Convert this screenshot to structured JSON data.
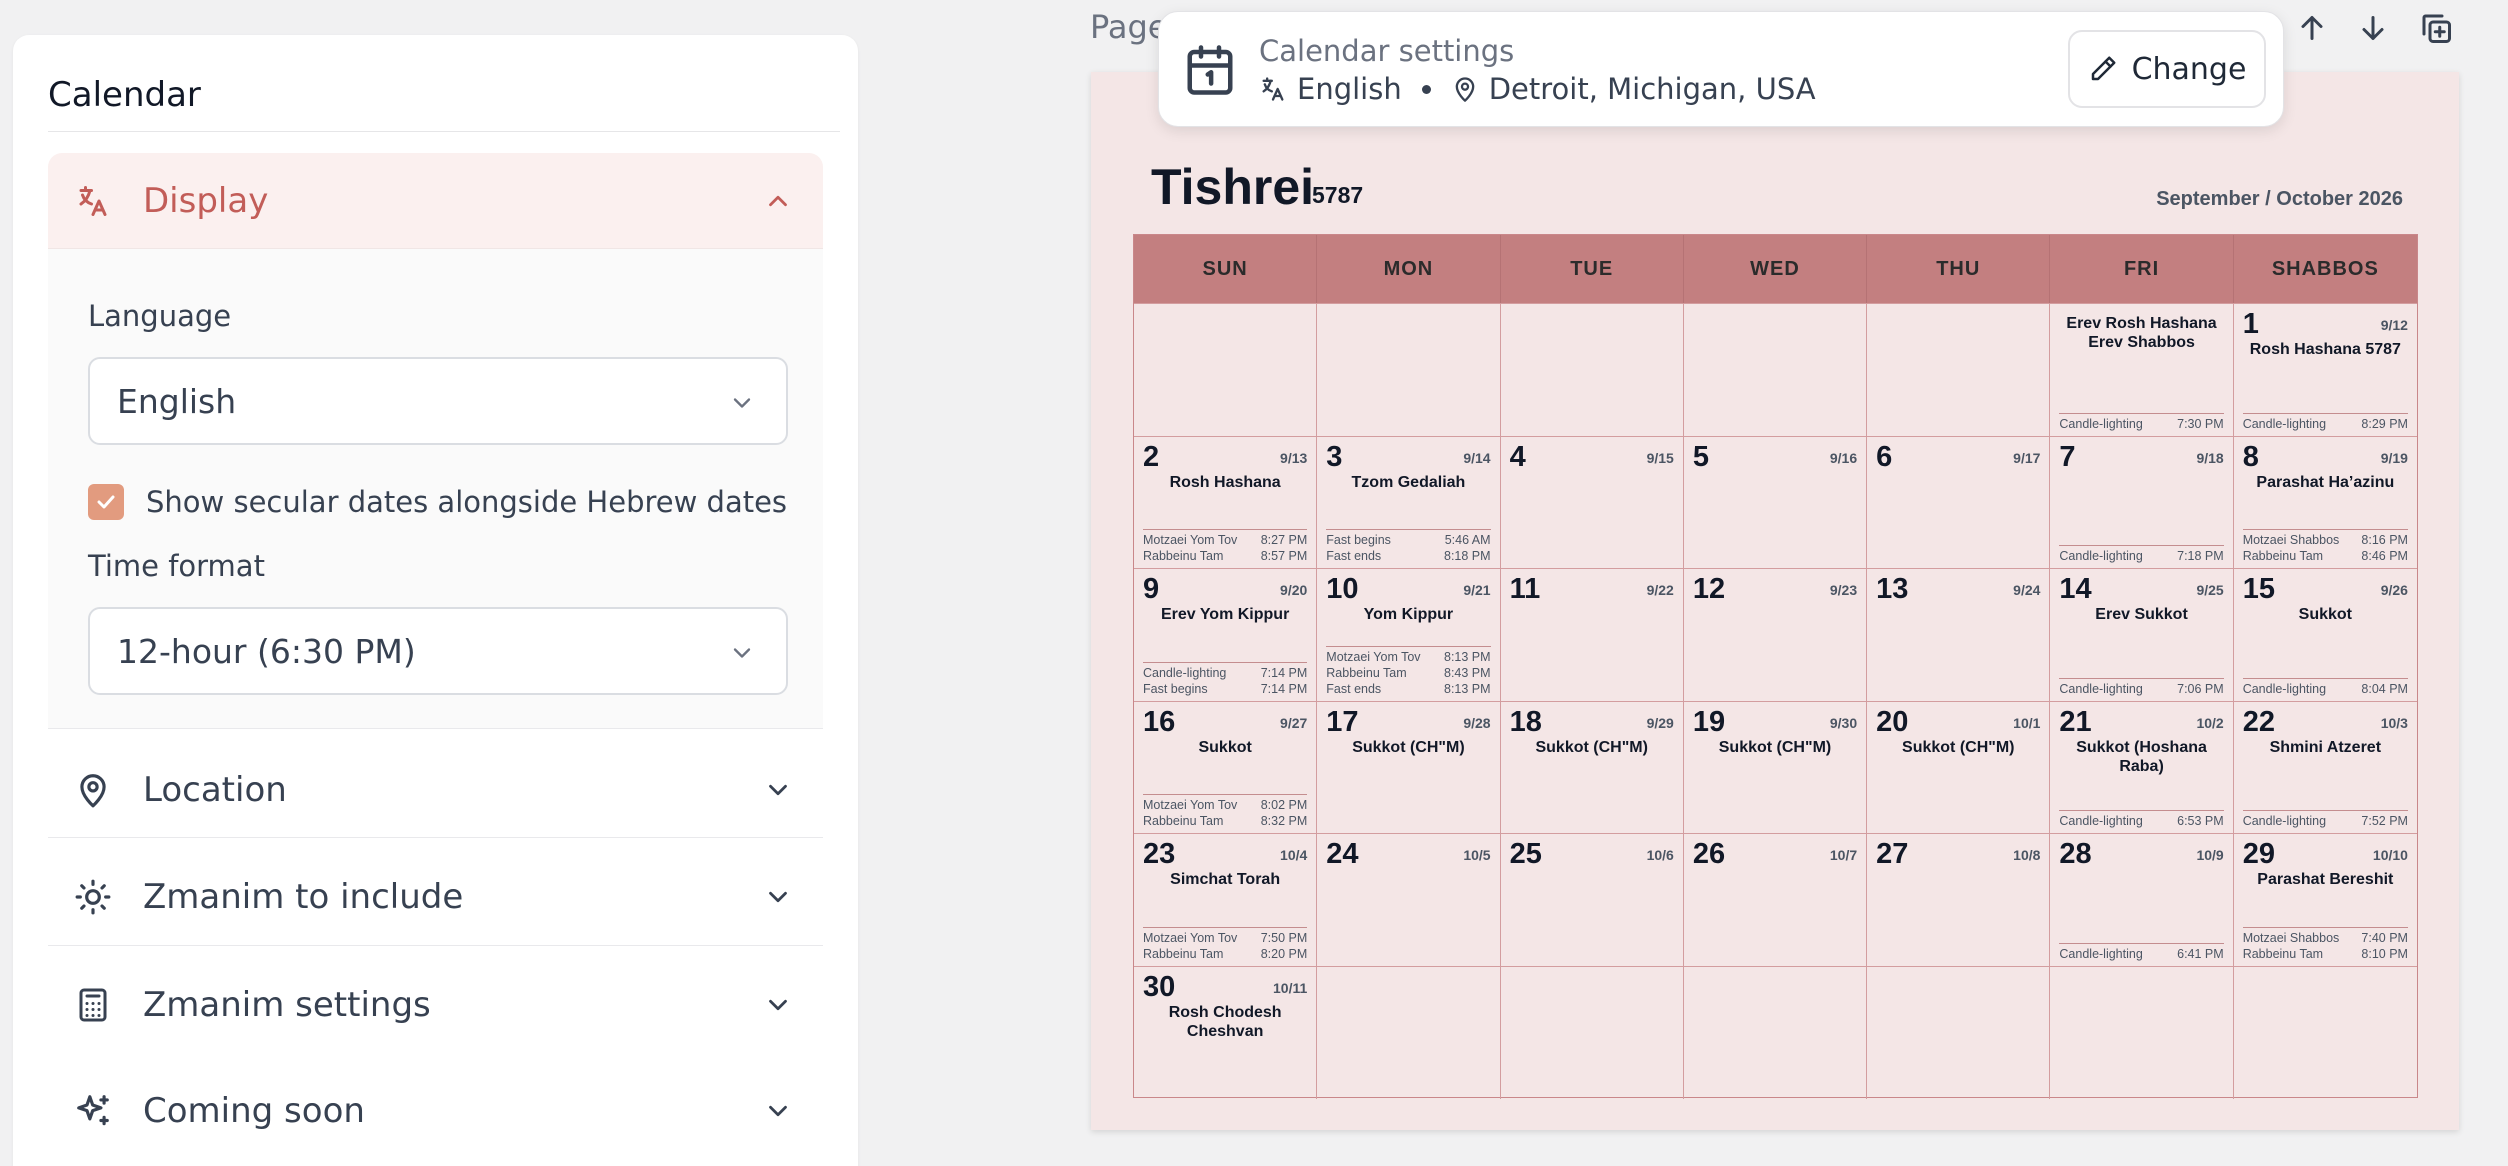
{
  "panel": {
    "title": "Calendar",
    "display": {
      "label": "Display",
      "language_label": "Language",
      "language_value": "English",
      "show_secular_label": "Show secular dates alongside Hebrew dates",
      "show_secular_checked": true,
      "time_format_label": "Time format",
      "time_format_value": "12-hour (6:30 PM)"
    },
    "sections": [
      {
        "label": "Location",
        "icon": "map-pin-icon"
      },
      {
        "label": "Zmanim to include",
        "icon": "sun-icon"
      },
      {
        "label": "Zmanim settings",
        "icon": "calculator-icon"
      },
      {
        "label": "Coming soon",
        "icon": "sparkles-icon"
      }
    ],
    "accent_color": "#c25d58"
  },
  "toolbar": {
    "page_label": "Page"
  },
  "popup": {
    "title": "Calendar settings",
    "language": "English",
    "location": "Detroit, Michigan, USA",
    "change_label": "Change"
  },
  "calendar": {
    "month": "Tishrei",
    "year": "5787",
    "secular_range": "September / October 2026",
    "days_of_week": [
      "SUN",
      "MON",
      "TUE",
      "WED",
      "THU",
      "FRI",
      "SHABBOS"
    ],
    "header_color": "#c37f80",
    "weeks": [
      [
        {},
        {},
        {},
        {},
        {},
        {
          "events": [
            "Erev Rosh Hashana",
            "Erev Shabbos"
          ],
          "zmanim": [
            [
              "Candle-lighting",
              "7:30 PM"
            ]
          ]
        },
        {
          "day": "1",
          "secular": "9/12",
          "events": [
            "Rosh Hashana 5787"
          ],
          "zmanim": [
            [
              "Candle-lighting",
              "8:29 PM"
            ]
          ]
        }
      ],
      [
        {
          "day": "2",
          "secular": "9/13",
          "events": [
            "Rosh Hashana"
          ],
          "zmanim": [
            [
              "Motzaei Yom Tov",
              "8:27 PM"
            ],
            [
              "Rabbeinu Tam",
              "8:57 PM"
            ]
          ]
        },
        {
          "day": "3",
          "secular": "9/14",
          "events": [
            "Tzom Gedaliah"
          ],
          "zmanim": [
            [
              "Fast begins",
              "5:46 AM"
            ],
            [
              "Fast ends",
              "8:18 PM"
            ]
          ]
        },
        {
          "day": "4",
          "secular": "9/15"
        },
        {
          "day": "5",
          "secular": "9/16"
        },
        {
          "day": "6",
          "secular": "9/17"
        },
        {
          "day": "7",
          "secular": "9/18",
          "zmanim": [
            [
              "Candle-lighting",
              "7:18 PM"
            ]
          ]
        },
        {
          "day": "8",
          "secular": "9/19",
          "events": [
            "Parashat Ha’azinu"
          ],
          "zmanim": [
            [
              "Motzaei Shabbos",
              "8:16 PM"
            ],
            [
              "Rabbeinu Tam",
              "8:46 PM"
            ]
          ]
        }
      ],
      [
        {
          "day": "9",
          "secular": "9/20",
          "events": [
            "Erev Yom Kippur"
          ],
          "zmanim": [
            [
              "Candle-lighting",
              "7:14 PM"
            ],
            [
              "Fast begins",
              "7:14 PM"
            ]
          ]
        },
        {
          "day": "10",
          "secular": "9/21",
          "events": [
            "Yom Kippur"
          ],
          "zmanim": [
            [
              "Motzaei Yom Tov",
              "8:13 PM"
            ],
            [
              "Rabbeinu Tam",
              "8:43 PM"
            ],
            [
              "Fast ends",
              "8:13 PM"
            ]
          ]
        },
        {
          "day": "11",
          "secular": "9/22"
        },
        {
          "day": "12",
          "secular": "9/23"
        },
        {
          "day": "13",
          "secular": "9/24"
        },
        {
          "day": "14",
          "secular": "9/25",
          "events": [
            "Erev Sukkot"
          ],
          "zmanim": [
            [
              "Candle-lighting",
              "7:06 PM"
            ]
          ]
        },
        {
          "day": "15",
          "secular": "9/26",
          "events": [
            "Sukkot"
          ],
          "zmanim": [
            [
              "Candle-lighting",
              "8:04 PM"
            ]
          ]
        }
      ],
      [
        {
          "day": "16",
          "secular": "9/27",
          "events": [
            "Sukkot"
          ],
          "zmanim": [
            [
              "Motzaei Yom Tov",
              "8:02 PM"
            ],
            [
              "Rabbeinu Tam",
              "8:32 PM"
            ]
          ]
        },
        {
          "day": "17",
          "secular": "9/28",
          "events": [
            "Sukkot (CH\"M)"
          ]
        },
        {
          "day": "18",
          "secular": "9/29",
          "events": [
            "Sukkot (CH\"M)"
          ]
        },
        {
          "day": "19",
          "secular": "9/30",
          "events": [
            "Sukkot (CH\"M)"
          ]
        },
        {
          "day": "20",
          "secular": "10/1",
          "events": [
            "Sukkot (CH\"M)"
          ]
        },
        {
          "day": "21",
          "secular": "10/2",
          "events": [
            "Sukkot (Hoshana Raba)"
          ],
          "zmanim": [
            [
              "Candle-lighting",
              "6:53 PM"
            ]
          ]
        },
        {
          "day": "22",
          "secular": "10/3",
          "events": [
            "Shmini Atzeret"
          ],
          "zmanim": [
            [
              "Candle-lighting",
              "7:52 PM"
            ]
          ]
        }
      ],
      [
        {
          "day": "23",
          "secular": "10/4",
          "events": [
            "Simchat Torah"
          ],
          "zmanim": [
            [
              "Motzaei Yom Tov",
              "7:50 PM"
            ],
            [
              "Rabbeinu Tam",
              "8:20 PM"
            ]
          ]
        },
        {
          "day": "24",
          "secular": "10/5"
        },
        {
          "day": "25",
          "secular": "10/6"
        },
        {
          "day": "26",
          "secular": "10/7"
        },
        {
          "day": "27",
          "secular": "10/8"
        },
        {
          "day": "28",
          "secular": "10/9",
          "zmanim": [
            [
              "Candle-lighting",
              "6:41 PM"
            ]
          ]
        },
        {
          "day": "29",
          "secular": "10/10",
          "events": [
            "Parashat Bereshit"
          ],
          "zmanim": [
            [
              "Motzaei Shabbos",
              "7:40 PM"
            ],
            [
              "Rabbeinu Tam",
              "8:10 PM"
            ]
          ]
        }
      ],
      [
        {
          "day": "30",
          "secular": "10/11",
          "events": [
            "Rosh Chodesh Cheshvan"
          ]
        },
        {},
        {},
        {},
        {},
        {},
        {}
      ]
    ]
  }
}
